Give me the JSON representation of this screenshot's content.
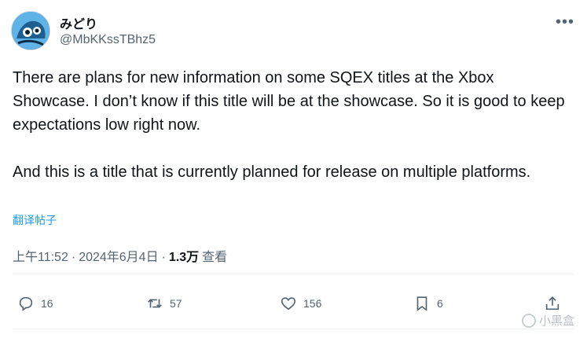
{
  "user": {
    "display_name": "みどり",
    "username": "@MbKKssTBhz5"
  },
  "tweet": {
    "text": "There are plans for new information on some SQEX titles at the Xbox Showcase. I don’t know if this title will be at the showcase. So it is good to keep expectations low right now.\n\nAnd this is a title that is currently planned for release on multiple platforms.",
    "translate_label": "翻译帖子"
  },
  "meta": {
    "time": "上午11:52",
    "separator": "·",
    "date": "2024年6月4日",
    "views_count": "1.3万",
    "views_label": "查看"
  },
  "actions": {
    "reply_count": "16",
    "retweet_count": "57",
    "like_count": "156",
    "bookmark_count": "6"
  },
  "icons": {
    "more": "more-horizontal-icon",
    "reply": "reply-icon",
    "retweet": "retweet-icon",
    "like": "heart-icon",
    "bookmark": "bookmark-icon",
    "share": "share-icon"
  },
  "watermark": {
    "text": "小黑盒"
  },
  "colors": {
    "text": "#0f1419",
    "secondary": "#536471",
    "link": "#1d9bf0",
    "divider": "#eff3f4"
  }
}
